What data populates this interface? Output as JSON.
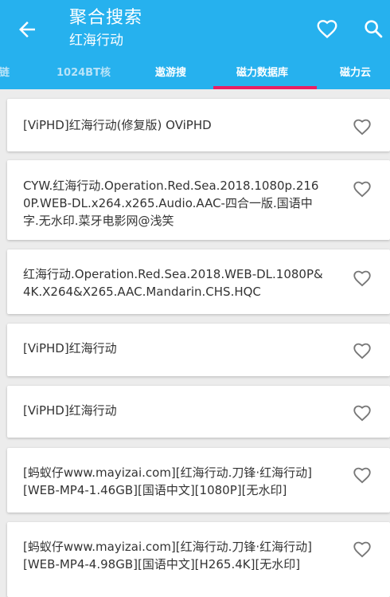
{
  "header": {
    "title": "聚合搜索",
    "subtitle": "红海行动"
  },
  "tabs": [
    {
      "label": "链"
    },
    {
      "label": "1024BT核"
    },
    {
      "label": "遨游搜"
    },
    {
      "label": "磁力数据库"
    },
    {
      "label": "磁力云"
    }
  ],
  "active_tab": "磁力数据库",
  "colors": {
    "primary": "#26b1ee",
    "indicator": "#e91e63"
  },
  "results": [
    {
      "title": "[ViPHD]红海行动(修复版) OViPHD"
    },
    {
      "title": "CYW.红海行动.Operation.Red.Sea.2018.1080p.2160P.WEB-DL.x264.x265.Audio.AAC-四合一版.国语中字.无水印.菜牙电影网@浅笑"
    },
    {
      "title": "红海行动.Operation.Red.Sea.2018.WEB-DL.1080P&4K.X264&X265.AAC.Mandarin.CHS.HQC"
    },
    {
      "title": "[ViPHD]红海行动"
    },
    {
      "title": "[ViPHD]红海行动"
    },
    {
      "title": "[蚂蚁仔www.mayizai.com][红海行动.刀锋·红海行动][WEB-MP4-1.46GB][国语中文][1080P][无水印]"
    },
    {
      "title": "[蚂蚁仔www.mayizai.com][红海行动.刀锋·红海行动][WEB-MP4-4.98GB][国语中文][H265.4K][无水印]"
    }
  ]
}
